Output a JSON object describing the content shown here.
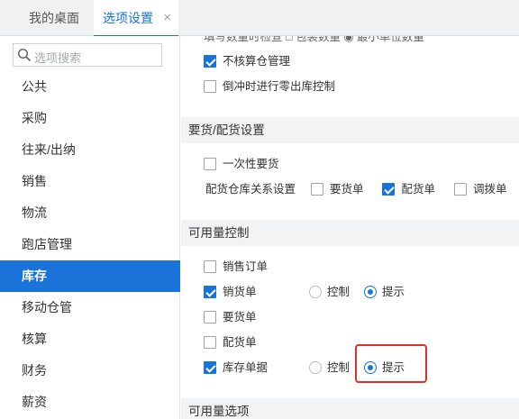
{
  "tabs": [
    {
      "label": "我的桌面"
    },
    {
      "label": "选项设置",
      "close": "×"
    }
  ],
  "sidebar": {
    "search_placeholder": "选项搜索",
    "items": [
      {
        "label": "公共"
      },
      {
        "label": "采购"
      },
      {
        "label": "往来/出纳"
      },
      {
        "label": "销售"
      },
      {
        "label": "物流"
      },
      {
        "label": "跑店管理"
      },
      {
        "label": "库存",
        "active": true
      },
      {
        "label": "移动仓管"
      },
      {
        "label": "核算"
      },
      {
        "label": "财务"
      },
      {
        "label": "薪资"
      }
    ]
  },
  "content": {
    "top_rows": {
      "clipped_row": "填写数量时检查   □ 包装数量  ◉ 最小单位数量",
      "not_calc_storage": {
        "label": "不核算仓管理",
        "checked": true
      },
      "offset_control": {
        "label": "倒冲时进行零出库控制",
        "checked": false
      }
    },
    "requisition_section": {
      "title": "要货/配货设置",
      "one_time": {
        "label": "一次性要货",
        "checked": false
      },
      "relation_label": "配货仓库关系设置",
      "relation_options": [
        {
          "label": "要货单",
          "checked": false
        },
        {
          "label": "配货单",
          "checked": true
        },
        {
          "label": "调拨单",
          "checked": false
        }
      ]
    },
    "available_section": {
      "title": "可用量控制",
      "items": [
        {
          "label": "销售订单",
          "checked": false
        },
        {
          "label": "销货单",
          "checked": true,
          "radio_control": "控制",
          "radio_prompt": "提示",
          "selected": "提示"
        },
        {
          "label": "要货单",
          "checked": false
        },
        {
          "label": "配货单",
          "checked": false
        },
        {
          "label": "库存单据",
          "checked": true,
          "radio_control": "控制",
          "radio_prompt": "提示",
          "selected": "提示"
        }
      ]
    },
    "available_options_section": {
      "title": "可用量选项"
    }
  },
  "colors": {
    "accent": "#1a73d9",
    "highlight_border": "#d9322b",
    "section_bg": "#f2f3f5"
  }
}
